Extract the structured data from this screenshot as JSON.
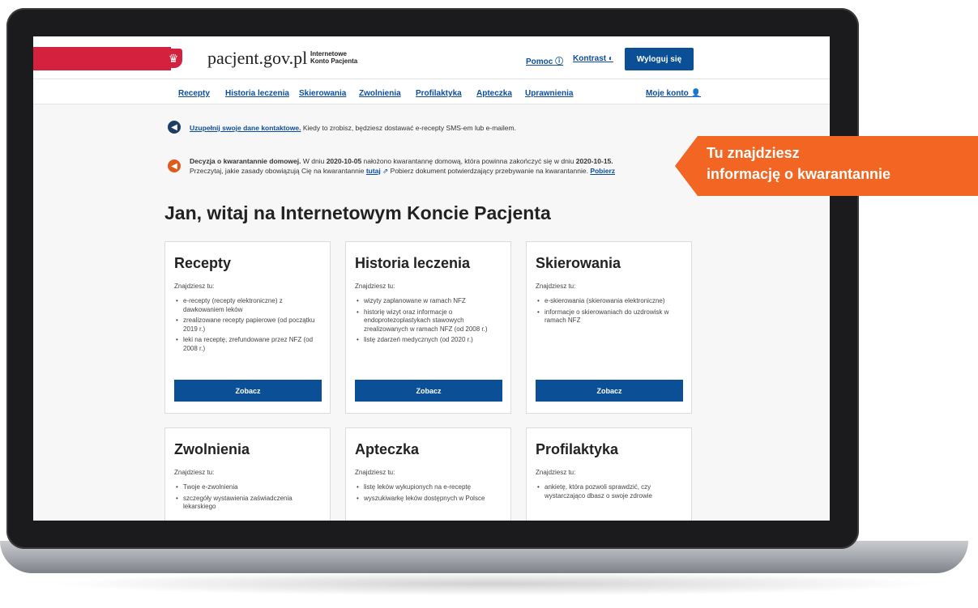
{
  "header": {
    "logo": "pacjent.gov.pl",
    "subtitle_line1": "Internetowe",
    "subtitle_line2": "Konto Pacjenta",
    "help": "Pomoc",
    "contrast": "Kontrast",
    "logout": "Wyloguj się"
  },
  "nav": {
    "items": [
      "Recepty",
      "Historia leczenia",
      "Skierowania",
      "Zwolnienia",
      "Profilaktyka",
      "Apteczka",
      "Uprawnienia"
    ],
    "account": "Moje konto"
  },
  "banner1": {
    "link": "Uzupełnij swoje dane kontaktowe.",
    "text": "Kiedy to zrobisz, będziesz dostawać e-recepty SMS-em lub e-mailem."
  },
  "banner2": {
    "bold": "Decyzja o kwarantannie domowej.",
    "text1": "W dniu",
    "date1": "2020-10-05",
    "text2": "nałożono kwarantannę domową, która powinna zakończyć się w dniu",
    "date2": "2020-10-15.",
    "line2a": "Przeczytaj, jakie zasady obowiązują Cię na kwarantannie",
    "link1": "tutaj",
    "line2b": "Pobierz dokument potwierdzający przebywanie na kwarantannie.",
    "link2": "Pobierz"
  },
  "welcome": "Jan, witaj na Internetowym Koncie Pacjenta",
  "cards": [
    {
      "title": "Recepty",
      "intro": "Znajdziesz tu:",
      "items": [
        "e-recepty (recepty elektroniczne) z dawkowaniem leków",
        "zrealizowane recepty papierowe (od początku 2019 r.)",
        "leki na receptę, zrefundowane przez NFZ (od 2008 r.)"
      ],
      "button": "Zobacz"
    },
    {
      "title": "Historia leczenia",
      "intro": "Znajdziesz tu:",
      "items": [
        "wizyty zaplanowane w ramach NFZ",
        "historię wizyt oraz informacje o endoprotezoplastykach stawowych zrealizowanych w ramach NFZ (od 2008 r.)",
        "listę zdarzeń medycznych (od 2020 r.)"
      ],
      "button": "Zobacz"
    },
    {
      "title": "Skierowania",
      "intro": "Znajdziesz tu:",
      "items": [
        "e-skierowania (skierowania elektroniczne)",
        "informacje o skierowaniach do uzdrowisk w ramach NFZ"
      ],
      "button": "Zobacz"
    },
    {
      "title": "Zwolnienia",
      "intro": "Znajdziesz tu:",
      "items": [
        "Twoje e-zwolnienia",
        "szczegóły wystawienia zaświadczenia lekarskiego"
      ]
    },
    {
      "title": "Apteczka",
      "intro": "Znajdziesz tu:",
      "items": [
        "listę leków wykupionych na e-receptę",
        "wyszukiwarkę leków dostępnych w Polsce"
      ]
    },
    {
      "title": "Profilaktyka",
      "intro": "Znajdziesz tu:",
      "items": [
        "ankietę, która pozwoli sprawdzić, czy wystarczająco dbasz o swoje zdrowie"
      ]
    }
  ],
  "callout": {
    "line1": "Tu znajdziesz",
    "line2": "informację o kwarantannie"
  },
  "colors": {
    "brand_red": "#d4213d",
    "primary_blue": "#0b5096",
    "callout_orange": "#f26522"
  }
}
